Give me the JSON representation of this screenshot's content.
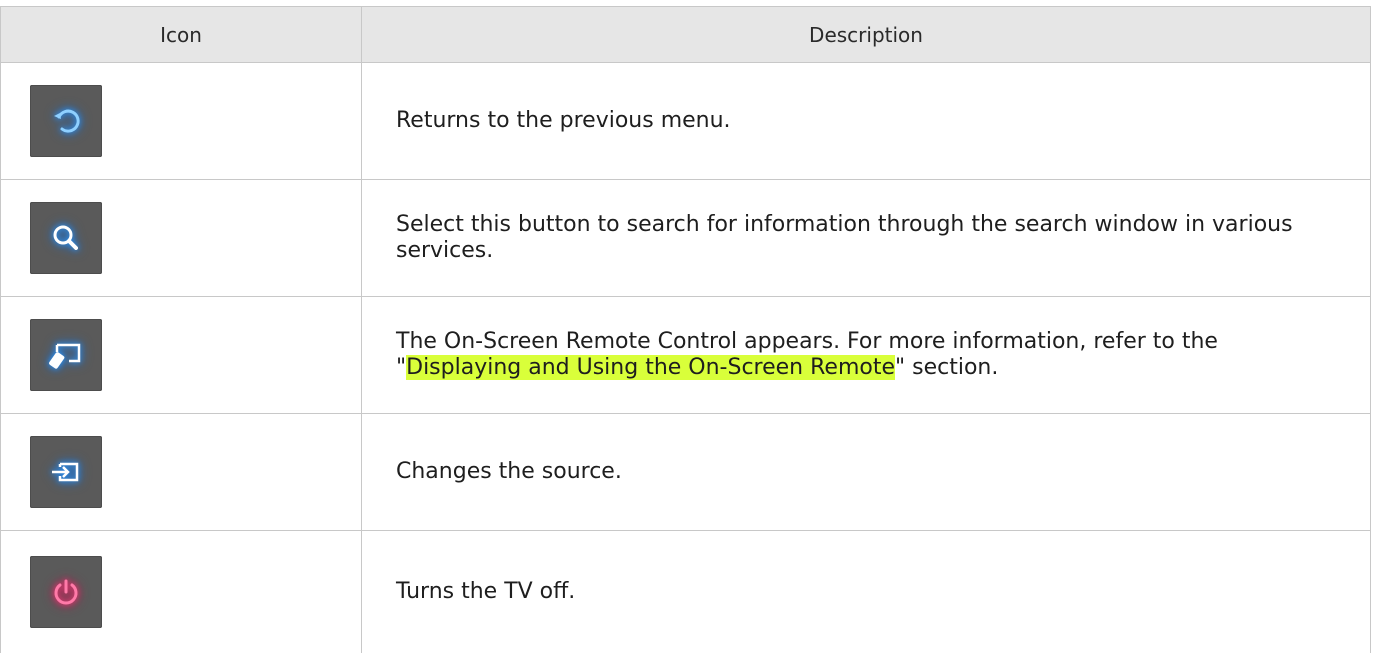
{
  "table": {
    "headers": {
      "icon": "Icon",
      "description": "Description"
    },
    "rows": [
      {
        "icon": "return-icon",
        "description": "Returns to the previous menu."
      },
      {
        "icon": "search-icon",
        "description": "Select this button to search for information through the search window in various services."
      },
      {
        "icon": "on-screen-remote-icon",
        "description_before": "The On-Screen Remote Control appears. For more information, refer to the \"",
        "description_link": "Displaying and Using the On-Screen Remote",
        "description_after": "\" section."
      },
      {
        "icon": "source-icon",
        "description": "Changes the source."
      },
      {
        "icon": "power-icon",
        "description": "Turns the TV off."
      }
    ]
  },
  "colors": {
    "header_bg": "#e6e6e6",
    "icon_bg": "#5a5a5a",
    "icon_blue": "#2f9bff",
    "icon_pink": "#ff3b80",
    "link_highlight": "#d9ff3a"
  }
}
